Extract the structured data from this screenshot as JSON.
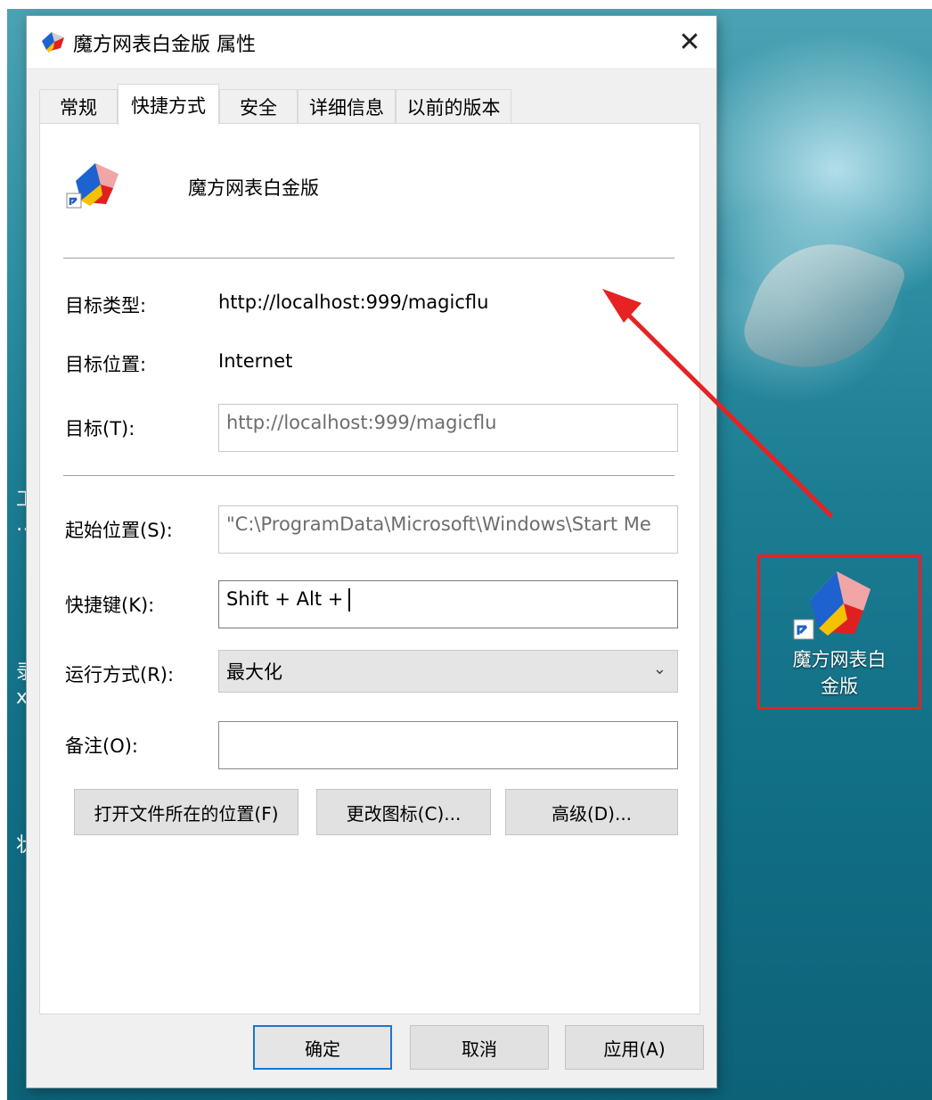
{
  "dialog": {
    "title": "魔方网表白金版 属性",
    "close_label": "✕"
  },
  "tabs": [
    "常规",
    "快捷方式",
    "安全",
    "详细信息",
    "以前的版本"
  ],
  "active_tab": "快捷方式",
  "shortcut": {
    "app_name": "魔方网表白金版",
    "target_type_label": "目标类型:",
    "target_type_value": "http://localhost:999/magicflu",
    "target_location_label": "目标位置:",
    "target_location_value": "Internet",
    "target_label": "目标(T):",
    "target_value": "http://localhost:999/magicflu",
    "start_in_label": "起始位置(S):",
    "start_in_value": "\"C:\\ProgramData\\Microsoft\\Windows\\Start Me",
    "hotkey_label": "快捷键(K):",
    "hotkey_value": "Shift + Alt +",
    "run_label": "运行方式(R):",
    "run_value": "最大化",
    "comment_label": "备注(O):",
    "comment_value": ""
  },
  "buttons": {
    "open_location": "打开文件所在的位置(F)",
    "change_icon": "更改图标(C)...",
    "advanced": "高级(D)..."
  },
  "footer": {
    "ok": "确定",
    "cancel": "取消",
    "apply": "应用(A)"
  },
  "desktop": {
    "icon_label_line1": "魔方网表白",
    "icon_label_line2": "金版",
    "edge_chars": [
      "工",
      "…",
      "录",
      "x",
      "状"
    ]
  },
  "colors": {
    "highlight_box": "#e62222",
    "arrow": "#e62222",
    "primary_button_border": "#1976d2"
  }
}
